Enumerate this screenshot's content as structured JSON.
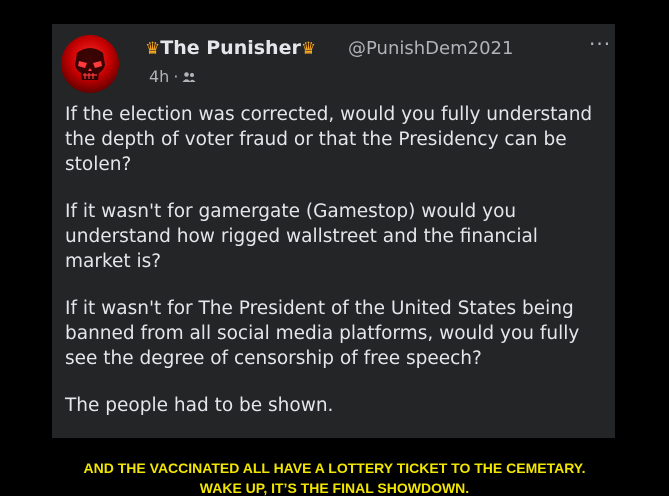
{
  "post": {
    "author": {
      "name": "The Punisher",
      "crown_left_icon": "crown-icon",
      "crown_right_icon": "crown-icon",
      "handle": "@PunishDem2021",
      "avatar_icon": "punisher-skull-icon"
    },
    "meta": {
      "time": "4h",
      "separator": "·",
      "audience_icon": "friends-icon"
    },
    "more_label": "···",
    "paragraphs": [
      "If the election was corrected, would you fully understand the depth of voter fraud or that the Presidency can be stolen?",
      "If it wasn't for gamergate (Gamestop) would you understand how rigged wallstreet and the financial market is?",
      "If it wasn't for The President of the United States being banned from all social media platforms, would you fully see the degree of censorship of free speech?",
      "The people had to be shown."
    ]
  },
  "caption": {
    "line1": "AND THE VACCINATED ALL HAVE A LOTTERY TICKET TO THE CEMETARY.",
    "line2": "WAKE UP, IT’S THE FINAL SHOWDOWN."
  },
  "colors": {
    "background": "#000000",
    "post_background": "#242526",
    "text": "#e4e6eb",
    "secondary_text": "#b0b3b8",
    "caption": "#f2e600",
    "avatar": "#c40000",
    "crown": "#f5a623"
  }
}
